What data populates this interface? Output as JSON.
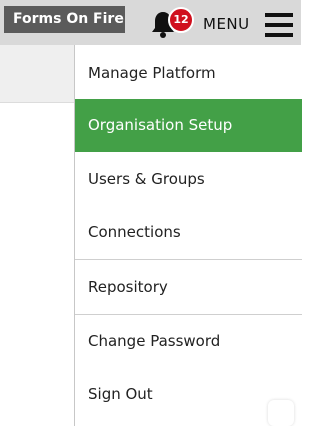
{
  "header": {
    "brand": "Forms On Fire",
    "notification_count": "12",
    "menu_label": "MENU"
  },
  "menu": {
    "items": [
      {
        "label": "Manage Platform"
      },
      {
        "label": "Organisation Setup",
        "active": true
      },
      {
        "label": "Users & Groups"
      },
      {
        "label": "Connections"
      },
      {
        "label": "Repository"
      },
      {
        "label": "Change Password"
      },
      {
        "label": "Sign Out"
      }
    ]
  },
  "colors": {
    "active_item": "#43a047",
    "badge": "#d0101e",
    "brand_bg": "#5b5b5b",
    "topbar_bg": "#d9d9d9"
  },
  "icons": [
    "bell-icon",
    "hamburger-menu-icon"
  ]
}
